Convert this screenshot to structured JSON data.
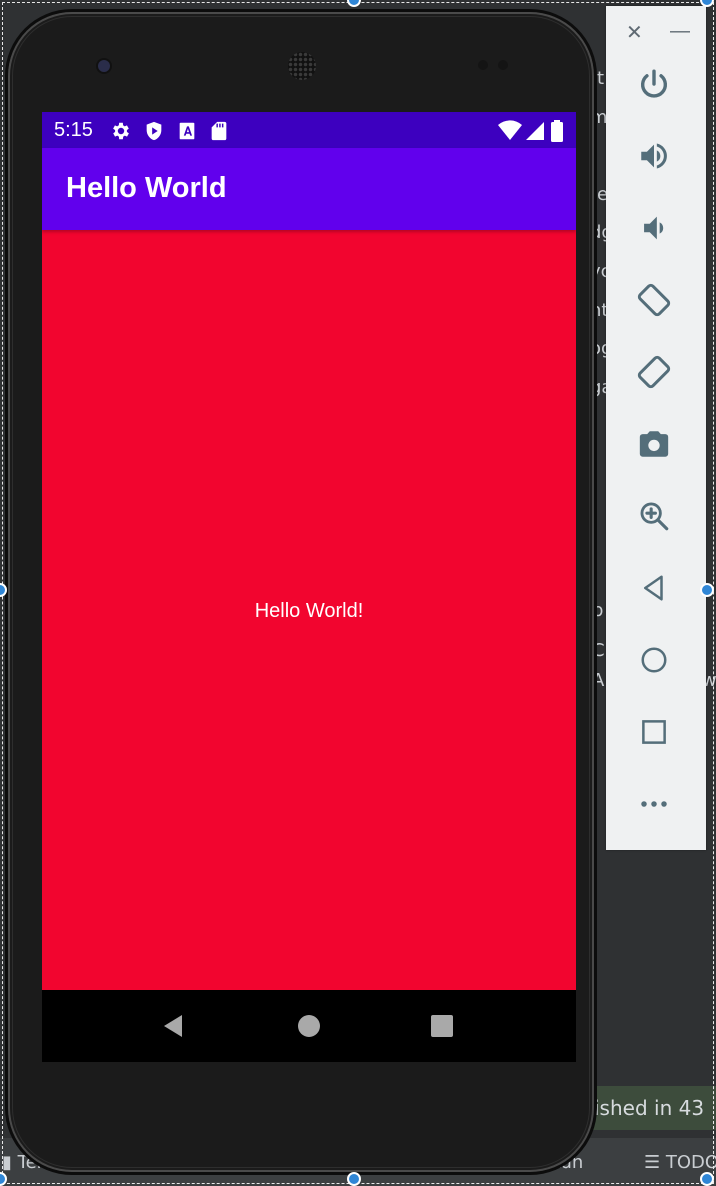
{
  "ide": {
    "side_fragments": [
      "tt",
      "m",
      "t",
      "te",
      "dg",
      "yc",
      "nt",
      "og",
      "ga"
    ],
    "right_fragments": [
      "p",
      "C",
      "Al",
      "w"
    ],
    "build_status": "ished in 43",
    "bottom_tabs": {
      "terminal": "Ter",
      "run": "Run",
      "todo": "TODO"
    }
  },
  "device": {
    "status_bar": {
      "time": "5:15",
      "icons": [
        "gear-icon",
        "shield-play-icon",
        "a-font-icon",
        "sd-card-icon",
        "wifi-icon",
        "signal-icon",
        "battery-icon"
      ]
    },
    "app_bar": {
      "title": "Hello World"
    },
    "content": {
      "text": "Hello World!"
    },
    "colors": {
      "status_bar": "#3d00bf",
      "app_bar": "#6100ed",
      "background": "#f2052f",
      "nav_bar": "#000000"
    },
    "nav_bar": {
      "buttons": [
        "back-icon",
        "home-icon",
        "recents-icon"
      ]
    }
  },
  "emulator_toolbar": {
    "window_controls": [
      "close-icon",
      "minimize-icon"
    ],
    "buttons": [
      "power-icon",
      "volume-up-icon",
      "volume-down-icon",
      "rotate-left-icon",
      "rotate-right-icon",
      "camera-icon",
      "zoom-icon",
      "back-icon",
      "home-icon",
      "overview-icon",
      "more-icon"
    ]
  }
}
